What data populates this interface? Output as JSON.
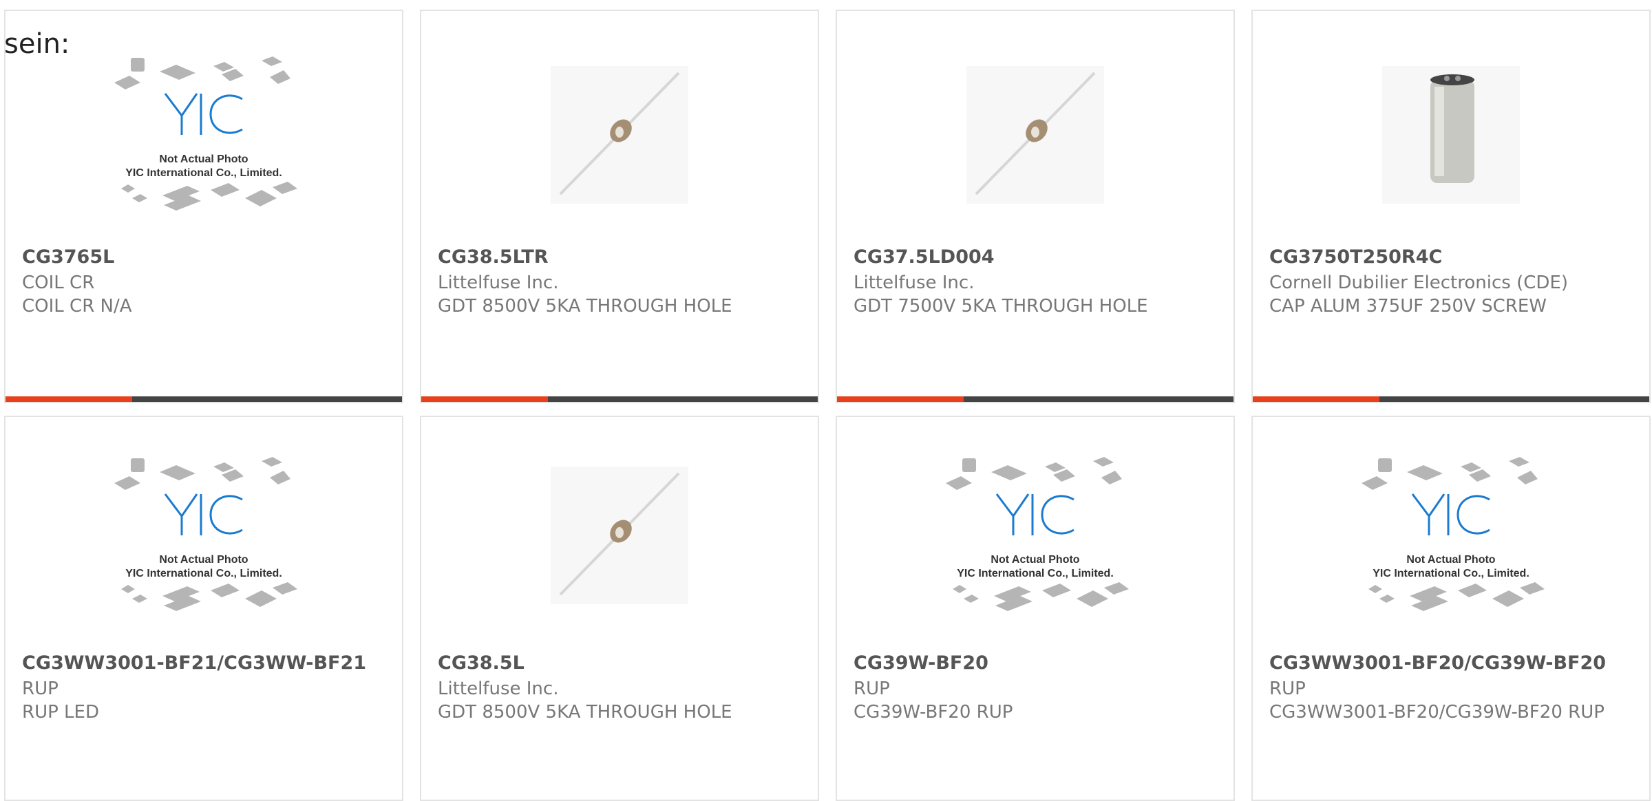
{
  "header": {
    "partial_text": "sein:"
  },
  "placeholder": {
    "line1": "Not Actual Photo",
    "line2": "YIC International Co., Limited.",
    "logo": "YIC"
  },
  "colors": {
    "accent": "#e8401c",
    "bar": "#444444",
    "logo": "#1a7bd0"
  },
  "products": [
    {
      "part": "CG3765L",
      "manufacturer": "COIL CR",
      "description": "COIL CR N/A",
      "image": "yic-placeholder-icon"
    },
    {
      "part": "CG38.5LTR",
      "manufacturer": "Littelfuse Inc.",
      "description": "GDT 8500V 5KA THROUGH HOLE",
      "image": "gas-discharge-tube-icon"
    },
    {
      "part": "CG37.5LD004",
      "manufacturer": "Littelfuse Inc.",
      "description": "GDT 7500V 5KA THROUGH HOLE",
      "image": "gas-discharge-tube-icon"
    },
    {
      "part": "CG3750T250R4C",
      "manufacturer": "Cornell Dubilier Electronics (CDE)",
      "description": "CAP ALUM 375UF 250V SCREW",
      "image": "capacitor-icon"
    },
    {
      "part": "CG3WW3001-BF21/CG3WW-BF21",
      "manufacturer": "RUP",
      "description": "RUP LED",
      "image": "yic-placeholder-icon"
    },
    {
      "part": "CG38.5L",
      "manufacturer": "Littelfuse Inc.",
      "description": "GDT 8500V 5KA THROUGH HOLE",
      "image": "gas-discharge-tube-icon"
    },
    {
      "part": "CG39W-BF20",
      "manufacturer": "RUP",
      "description": "CG39W-BF20 RUP",
      "image": "yic-placeholder-icon"
    },
    {
      "part": "CG3WW3001-BF20/CG39W-BF20",
      "manufacturer": "RUP",
      "description": "CG3WW3001-BF20/CG39W-BF20 RUP",
      "image": "yic-placeholder-icon"
    }
  ]
}
